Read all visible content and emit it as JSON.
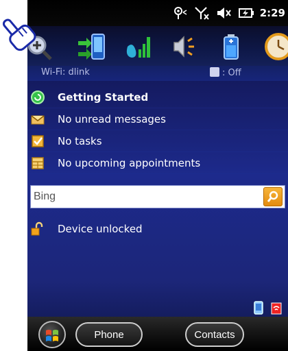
{
  "status_bar": {
    "time": "2:29",
    "icons": [
      "antenna-signal-icon",
      "no-signal-icon",
      "speaker-muted-icon",
      "battery-charging-icon"
    ]
  },
  "icon_bar": {
    "icons": [
      "zoom-icon",
      "phone-sync-icon",
      "phone-signal-icon",
      "volume-icon",
      "battery-icon",
      "clock-icon"
    ]
  },
  "connection_line": {
    "wifi": "Wi-Fi: dlink",
    "bluetooth": ": Off"
  },
  "today_items": [
    {
      "label": "Getting Started",
      "icon": "getting-started-icon",
      "bold": true
    },
    {
      "label": "No unread messages",
      "icon": "envelope-icon",
      "bold": false
    },
    {
      "label": "No tasks",
      "icon": "tasks-icon",
      "bold": false
    },
    {
      "label": "No upcoming appointments",
      "icon": "calendar-icon",
      "bold": false
    }
  ],
  "search": {
    "value": "Bing",
    "button_icon": "search-icon"
  },
  "lock": {
    "label": "Device unlocked",
    "icon": "unlocked-padlock-icon"
  },
  "soft_keys": {
    "start_icon": "windows-start-icon",
    "left": "Phone",
    "right": "Contacts"
  },
  "colors": {
    "background_top": "#0a0a26",
    "background_mid": "#1d2a8c",
    "search_button": "#f0a020",
    "text": "#ffffff"
  }
}
